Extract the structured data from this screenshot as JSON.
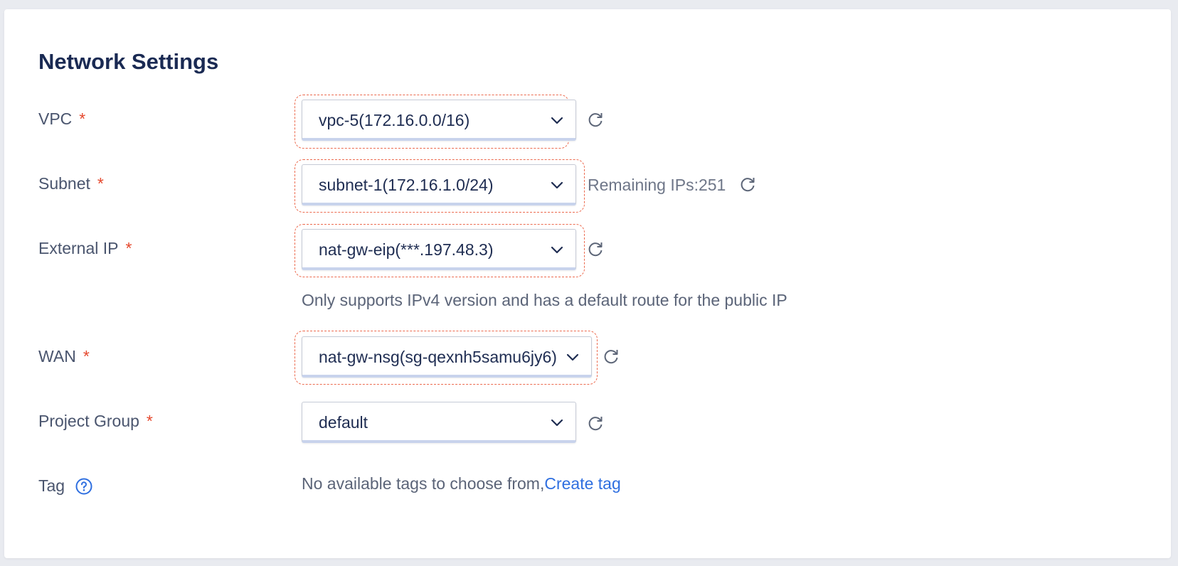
{
  "section": {
    "title": "Network Settings"
  },
  "required_mark": "*",
  "fields": {
    "vpc": {
      "label": "VPC",
      "value": "vpc-5(172.16.0.0/16)"
    },
    "subnet": {
      "label": "Subnet",
      "value": "subnet-1(172.16.1.0/24)",
      "remaining": "Remaining IPs:251"
    },
    "external_ip": {
      "label": "External IP",
      "value": "nat-gw-eip(***.197.48.3)",
      "hint": "Only supports IPv4 version and has a default route for the public IP"
    },
    "wan": {
      "label": "WAN",
      "value": "nat-gw-nsg(sg-qexnh5samu6jy6)"
    },
    "project_group": {
      "label": "Project Group",
      "value": "default"
    },
    "tag": {
      "label": "Tag",
      "empty_text": "No available tags to choose from,",
      "create_link": "Create tag"
    }
  },
  "icons": {
    "chevron": "chevron-down-icon",
    "refresh": "refresh-icon",
    "help": "question-circle-icon"
  },
  "colors": {
    "accent": "#2f6fe0",
    "required": "#e5482d",
    "error_outline": "#ec6a4e",
    "title": "#1a2a53"
  }
}
